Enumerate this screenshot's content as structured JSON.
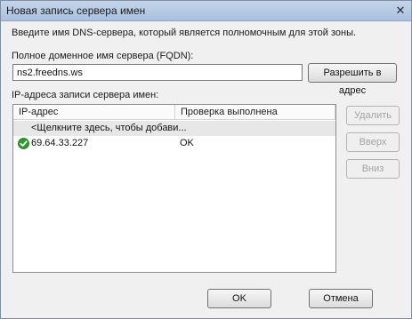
{
  "window": {
    "title": "Новая запись сервера имен",
    "close_glyph": "✕"
  },
  "description": "Введите имя DNS-сервера, который является полномочным для этой зоны.",
  "fqdn": {
    "label": "Полное доменное имя сервера (FQDN):",
    "value": "ns2.freedns.ws",
    "resolve_button": "Разрешить в адрес"
  },
  "ip_list": {
    "label": "IP-адреса записи сервера имен:",
    "columns": [
      "IP-адрес",
      "Проверка выполнена"
    ],
    "placeholder_row": "<Щелкните здесь, чтобы добави...",
    "rows": [
      {
        "ip": "69.64.33.227",
        "status": "OK",
        "icon": "green-check-icon"
      }
    ]
  },
  "side_buttons": {
    "delete": "Удалить",
    "up": "Вверх",
    "down": "Вниз"
  },
  "footer": {
    "ok": "OK",
    "cancel": "Отмена"
  }
}
